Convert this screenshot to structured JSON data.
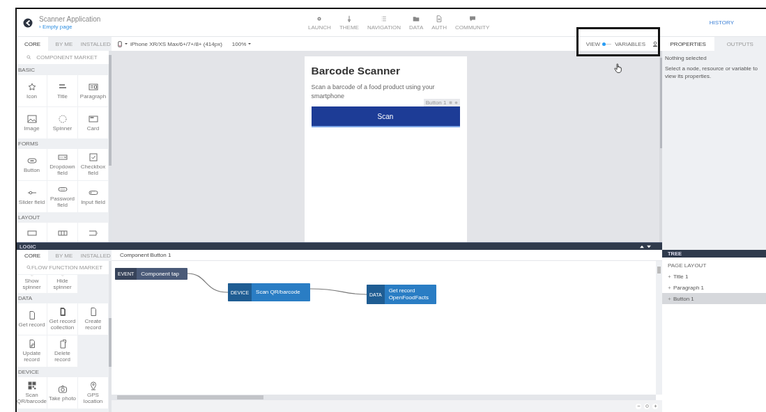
{
  "header": {
    "title": "Scanner Application",
    "breadcrumb": "› Empty page",
    "nav": [
      {
        "label": "LAUNCH"
      },
      {
        "label": "THEME"
      },
      {
        "label": "NAVIGATION"
      },
      {
        "label": "DATA"
      },
      {
        "label": "AUTH"
      },
      {
        "label": "COMMUNITY"
      }
    ],
    "history": "HISTORY"
  },
  "component_panel": {
    "tabs": [
      {
        "label": "CORE",
        "selected": true
      },
      {
        "label": "BY ME",
        "selected": false
      },
      {
        "label": "INSTALLED",
        "selected": false
      }
    ],
    "search": {
      "placeholder": "COMPONENT MARKET"
    },
    "groups": [
      {
        "title": "BASIC",
        "items": [
          {
            "kind": "tile",
            "label": "Icon"
          },
          {
            "kind": "tile",
            "label": "Title"
          },
          {
            "kind": "tile",
            "label": "Paragraph"
          },
          {
            "kind": "tile",
            "label": "Image"
          },
          {
            "kind": "tile",
            "label": "Spinner"
          },
          {
            "kind": "tile",
            "label": "Card"
          }
        ]
      },
      {
        "title": "FORMS",
        "items": [
          {
            "kind": "tile",
            "label": "Button"
          },
          {
            "kind": "tile",
            "label": "Dropdown field"
          },
          {
            "kind": "tile",
            "label": "Checkbox field"
          },
          {
            "kind": "tile",
            "label": "Slider field"
          },
          {
            "kind": "tile",
            "label": "Password field"
          },
          {
            "kind": "tile",
            "label": "Input field"
          }
        ]
      },
      {
        "title": "LAYOUT",
        "items": [
          {
            "kind": "bottom-cut"
          },
          {
            "kind": "bottom-cut"
          },
          {
            "kind": "bottom-cut"
          }
        ]
      }
    ]
  },
  "toolbar": {
    "device": "iPhone XR/XS Max/6+/7+/8+ (414px)",
    "zoom": "100%",
    "mode_toggle": {
      "left_label": "VIEW",
      "right_label": "VARIABLES",
      "on": false
    }
  },
  "preview": {
    "title": "Barcode Scanner",
    "paragraph": "Scan a barcode of a food product using your smartphone",
    "button": "Scan",
    "button_tag": "Button 1"
  },
  "properties_panel": {
    "tabs": [
      {
        "label": "PROPERTIES",
        "selected": true
      },
      {
        "label": "OUTPUTS",
        "selected": false
      }
    ],
    "heading": "Nothing selected",
    "hint": "Select a node, resource or variable to view its properties."
  },
  "logic_bar": {
    "title": "LOGIC"
  },
  "flow_panel": {
    "tabs": [
      {
        "label": "CORE",
        "selected": true
      },
      {
        "label": "BY ME",
        "selected": false
      },
      {
        "label": "INSTALLED",
        "selected": false
      }
    ],
    "search": {
      "placeholder": "FLOW FUNCTION MARKET"
    },
    "groups": [
      {
        "items": [
          {
            "kind": "top-cut",
            "label": "Show spinner"
          },
          {
            "kind": "top-cut",
            "label": "Hide spinner"
          }
        ]
      },
      {
        "title": "DATA",
        "items": [
          {
            "kind": "tile",
            "label": "Get record"
          },
          {
            "kind": "tile",
            "label": "Get record collection"
          },
          {
            "kind": "tile",
            "label": "Create record"
          },
          {
            "kind": "tile",
            "label": "Update record"
          },
          {
            "kind": "tile",
            "label": "Delete record"
          }
        ]
      },
      {
        "title": "DEVICE",
        "items": [
          {
            "kind": "tile",
            "label": "Scan QR/barcode"
          },
          {
            "kind": "tile",
            "label": "Take photo"
          },
          {
            "kind": "tile",
            "label": "GPS location"
          }
        ]
      }
    ]
  },
  "flow_editor": {
    "title": "Component Button 1",
    "nodes": [
      {
        "tag": "EVENT",
        "label": "Component tap",
        "color": "#4a5a78"
      },
      {
        "tag": "DEVICE",
        "label": "Scan QR/barcode",
        "color": "#2a7dc4"
      },
      {
        "tag": "DATA",
        "label": "Get record OpenFoodFacts",
        "color": "#2a7dc4"
      }
    ]
  },
  "tree": {
    "title": "TREE",
    "section": "PAGE LAYOUT",
    "items": [
      {
        "label": "Title 1",
        "selected": false
      },
      {
        "label": "Paragraph 1",
        "selected": false
      },
      {
        "label": "Button 1",
        "selected": true
      }
    ]
  }
}
